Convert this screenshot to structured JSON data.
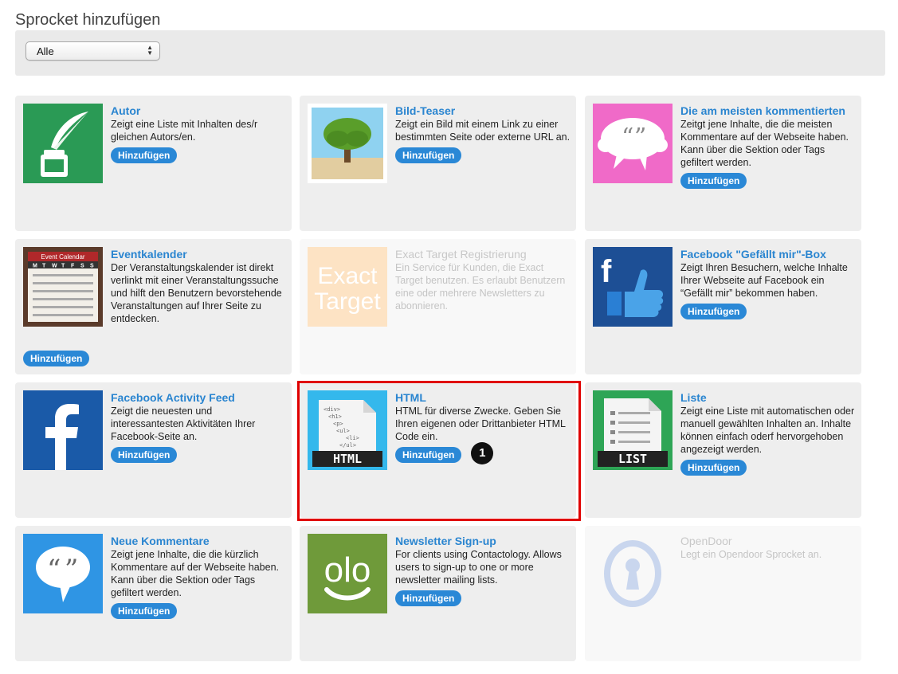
{
  "page": {
    "title": "Sprocket hinzufügen"
  },
  "filter": {
    "selected": "Alle"
  },
  "add_label": "Hinzufügen",
  "highlight_badge": "1",
  "cards": [
    {
      "title": "Autor",
      "desc": "Zeigt eine Liste mit Inhalten des/r gleichen Autors/en.",
      "icon": "quill-ink-icon"
    },
    {
      "title": "Bild-Teaser",
      "desc": "Zeigt ein Bild mit einem Link zu einer bestimmten Seite oder externe URL an.",
      "icon": "tree-photo-icon"
    },
    {
      "title": "Die am meisten kommentierten",
      "desc": "Zeitgt jene Inhalte, die die meisten Kommentare auf der Webseite haben. Kann über die Sektion oder Tags gefiltert werden.",
      "icon": "speech-bubbles-icon"
    },
    {
      "title": "Eventkalender",
      "desc": "Der Veranstaltungskalender ist direkt verlinkt mit einer Veranstaltungssuche und hilft den Benutzern bevorstehende Veranstaltungen auf Ihrer Seite zu entdecken.",
      "icon": "event-calendar-icon",
      "icon_label": "Event Calendar",
      "weekdays": [
        "M",
        "T",
        "W",
        "T",
        "F",
        "S",
        "S"
      ]
    },
    {
      "title": "Exact Target Registrierung",
      "desc": "Ein Service für Kunden, die Exact Target benutzen. Es erlaubt Benutzern eine oder mehrere Newsletters zu abonnieren.",
      "icon": "exact-target-icon",
      "icon_label_1": "Exact",
      "icon_label_2": "Target"
    },
    {
      "title": "Facebook \"Gefällt mir\"-Box",
      "desc": "Zeigt Ihren Besuchern, welche Inhalte Ihrer Webseite auf Facebook ein “Gefällt mir” bekommen haben.",
      "icon": "facebook-like-icon"
    },
    {
      "title": "Facebook Activity Feed",
      "desc": "Zeigt die neuesten und interessantesten Aktivitäten Ihrer Facebook-Seite an.",
      "icon": "facebook-icon"
    },
    {
      "title": "HTML",
      "desc": "HTML für diverse Zwecke. Geben Sie Ihren eigenen oder Drittanbieter HTML Code ein.",
      "icon": "html-file-icon",
      "icon_label": "HTML",
      "code_lines": [
        "<div>",
        "<h1>",
        "<p>",
        "<ul>",
        "<li>",
        "</ul>"
      ]
    },
    {
      "title": "Liste",
      "desc": "Zeigt eine Liste mit automatischen oder manuell gewählten Inhalten an. Inhalte können einfach oderf hervorgehoben angezeigt werden.",
      "icon": "list-file-icon",
      "icon_label": "LIST"
    },
    {
      "title": "Neue Kommentare",
      "desc": "Zeigt jene Inhalte, die die kürzlich Kommentare auf der Webseite haben. Kann über die Sektion oder Tags gefiltert werden.",
      "icon": "comment-bubble-icon"
    },
    {
      "title": "Newsletter Sign-up",
      "desc": "For clients using Contactology. Allows users to sign-up to one or more newsletter mailing lists.",
      "icon": "contactology-icon",
      "icon_label": "olo"
    },
    {
      "title": "OpenDoor",
      "desc": "Legt ein Opendoor Sprocket an.",
      "icon": "keyhole-icon"
    }
  ]
}
